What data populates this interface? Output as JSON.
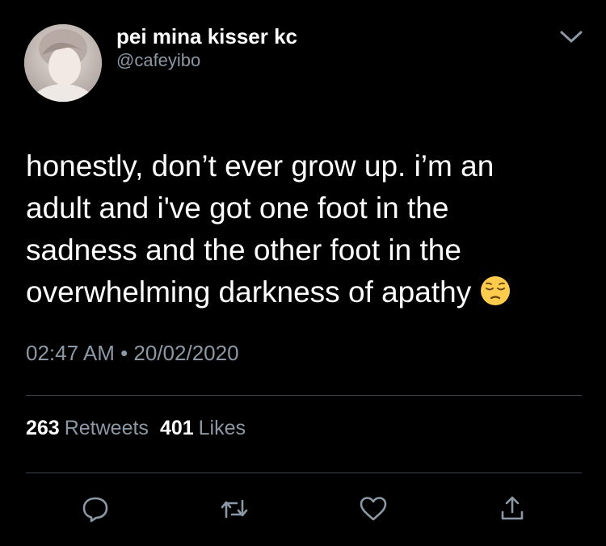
{
  "user": {
    "display_name": "pei mina kisser kc",
    "handle": "@cafeyibo"
  },
  "tweet": {
    "lines": [
      "honestly, don’t ever grow up. i’m an",
      "adult and i've got one foot in the",
      "sadness and the other foot in the",
      "overwhelming darkness of apathy"
    ],
    "emoji": "pensive-face-emoji",
    "timestamp": "02:47 AM • 20/02/2020"
  },
  "stats": {
    "retweets_count": "263",
    "retweets_label": "Retweets",
    "likes_count": "401",
    "likes_label": "Likes"
  },
  "actions": {
    "icons": [
      "reply-icon",
      "retweet-icon",
      "like-icon",
      "share-icon"
    ]
  },
  "colors": {
    "background": "#000000",
    "primary_text": "#ffffff",
    "secondary_text": "#8b98a5",
    "divider": "#38444d"
  }
}
